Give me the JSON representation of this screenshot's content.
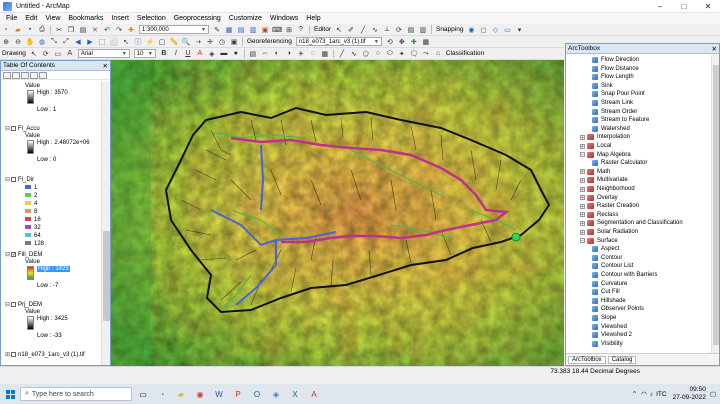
{
  "window": {
    "title": "Untitled - ArcMap",
    "controls": [
      "–",
      "□",
      "✕"
    ]
  },
  "menu": [
    "File",
    "Edit",
    "View",
    "Bookmarks",
    "Insert",
    "Selection",
    "Geoprocessing",
    "Customize",
    "Windows",
    "Help"
  ],
  "toolbar": {
    "scale": "1:300,000",
    "georeferencing_label": "Georeferencing",
    "layer_combo": "n18_e073_1arc_v3 (1).tif",
    "editor_label": "Editor",
    "snapping_label": "Snapping",
    "drawing_label": "Drawing",
    "font_name": "Arial",
    "font_size": "10",
    "classification_label": "Classification"
  },
  "toc": {
    "header": "Table Of Contents",
    "layers": [
      {
        "name": "Fl_Accu",
        "value_label": "Value",
        "high": "High : 2.48072e+06",
        "low": "Low : 0"
      },
      {
        "name": "Fl_Dir",
        "classes": [
          "1",
          "2",
          "4",
          "8",
          "16",
          "32",
          "64",
          "128"
        ],
        "class_colors": [
          "#4a63e0",
          "#5ec95e",
          "#e0d24a",
          "#e09a4a",
          "#c94a4a",
          "#9b4ac9",
          "#4ac9c9",
          "#7a7a7a"
        ]
      },
      {
        "name": "Fill_DEM",
        "value_label": "Value",
        "high": "High : 1425",
        "low": "Low : -7"
      },
      {
        "name": "Prj_DEM",
        "value_label": "Value",
        "high": "High : 3425",
        "low": "Low : -33"
      },
      {
        "name": "n18_e073_1arc_v3 (1).tif"
      }
    ],
    "top_legend": {
      "value_label": "Value",
      "high": "High : 3570",
      "low": "Low : 1"
    }
  },
  "toolbox": {
    "header": "ArcToolbox",
    "items": [
      {
        "label": "Flow Direction",
        "kind": "tool",
        "level": 2
      },
      {
        "label": "Flow Distance",
        "kind": "tool",
        "level": 2
      },
      {
        "label": "Flow Length",
        "kind": "tool",
        "level": 2
      },
      {
        "label": "Sink",
        "kind": "tool",
        "level": 2
      },
      {
        "label": "Snap Pour Point",
        "kind": "tool",
        "level": 2
      },
      {
        "label": "Stream Link",
        "kind": "tool",
        "level": 2
      },
      {
        "label": "Stream Order",
        "kind": "tool",
        "level": 2
      },
      {
        "label": "Stream to Feature",
        "kind": "tool",
        "level": 2
      },
      {
        "label": "Watershed",
        "kind": "tool",
        "level": 2
      },
      {
        "label": "Interpolation",
        "kind": "box",
        "level": 1,
        "sign": "+"
      },
      {
        "label": "Local",
        "kind": "box",
        "level": 1,
        "sign": "+"
      },
      {
        "label": "Map Algebra",
        "kind": "box",
        "level": 1,
        "sign": "−"
      },
      {
        "label": "Raster Calculator",
        "kind": "tool",
        "level": 2
      },
      {
        "label": "Math",
        "kind": "box",
        "level": 1,
        "sign": "+"
      },
      {
        "label": "Multivariate",
        "kind": "box",
        "level": 1,
        "sign": "+"
      },
      {
        "label": "Neighborhood",
        "kind": "box",
        "level": 1,
        "sign": "+"
      },
      {
        "label": "Overlay",
        "kind": "box",
        "level": 1,
        "sign": "+"
      },
      {
        "label": "Raster Creation",
        "kind": "box",
        "level": 1,
        "sign": "+"
      },
      {
        "label": "Reclass",
        "kind": "box",
        "level": 1,
        "sign": "+"
      },
      {
        "label": "Segmentation and Classification",
        "kind": "box",
        "level": 1,
        "sign": "+"
      },
      {
        "label": "Solar Radiation",
        "kind": "box",
        "level": 1,
        "sign": "+"
      },
      {
        "label": "Surface",
        "kind": "box",
        "level": 1,
        "sign": "−"
      },
      {
        "label": "Aspect",
        "kind": "tool",
        "level": 2
      },
      {
        "label": "Contour",
        "kind": "tool",
        "level": 2
      },
      {
        "label": "Contour List",
        "kind": "tool",
        "level": 2
      },
      {
        "label": "Contour with Barriers",
        "kind": "tool",
        "level": 2
      },
      {
        "label": "Curvature",
        "kind": "tool",
        "level": 2
      },
      {
        "label": "Cut Fill",
        "kind": "tool",
        "level": 2
      },
      {
        "label": "Hillshade",
        "kind": "tool",
        "level": 2
      },
      {
        "label": "Observer Points",
        "kind": "tool",
        "level": 2
      },
      {
        "label": "Slope",
        "kind": "tool",
        "level": 2
      },
      {
        "label": "Viewshed",
        "kind": "tool",
        "level": 2
      },
      {
        "label": "Viewshed 2",
        "kind": "tool",
        "level": 2
      },
      {
        "label": "Visibility",
        "kind": "tool",
        "level": 2
      }
    ],
    "tabs": [
      "ArcToolbox",
      "Catalog"
    ]
  },
  "status": {
    "coords": "73.383  18.44 Decimal Degrees"
  },
  "taskbar": {
    "search_placeholder": "Type here to search",
    "weather": "ENG",
    "lang": "ITC",
    "time": "09:50",
    "date": "27-09-2022",
    "weather_label": "",
    "colors": {
      "taskbar": "#dfe6ee",
      "accent": "#0078d7"
    }
  }
}
